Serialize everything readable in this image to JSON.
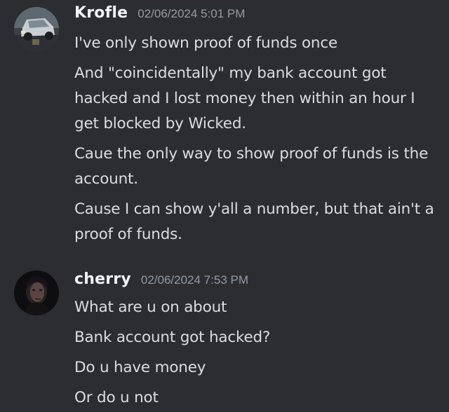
{
  "messages": [
    {
      "username": "Krofle",
      "timestamp": "02/06/2024 5:01 PM",
      "avatar_icon": "car-photo-avatar",
      "username_color": "#f2f3f5",
      "lines": [
        "I've only shown proof of funds once",
        "And \"coincidentally\" my bank account got hacked and I lost money then within an hour I get blocked by Wicked.",
        "Caue the only way to show proof of funds is the account.",
        "Cause I can show y'all a number, but that ain't a proof of funds."
      ]
    },
    {
      "username": "cherry",
      "timestamp": "02/06/2024 7:53 PM",
      "avatar_icon": "portrait-photo-avatar",
      "username_color": "#f2f3f5",
      "lines": [
        "What are u on about",
        "Bank account got hacked?",
        "Do u have money",
        "Or do u not"
      ]
    }
  ],
  "colors": {
    "background": "#2b2d31",
    "text": "#dbdee1",
    "timestamp": "#949ba4"
  }
}
